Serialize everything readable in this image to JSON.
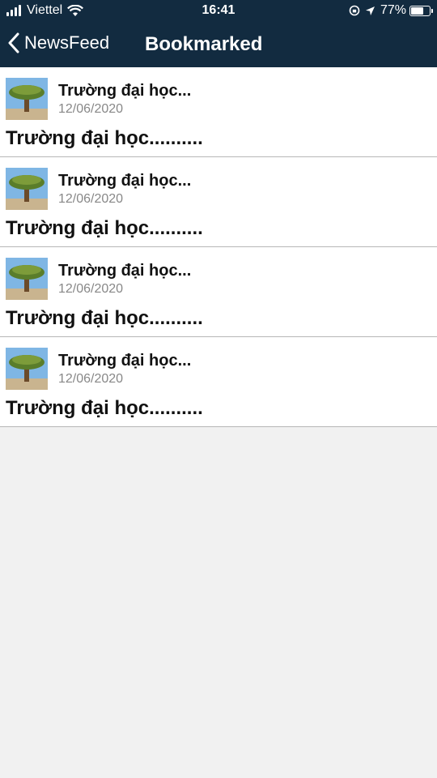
{
  "status_bar": {
    "carrier": "Viettel",
    "time": "16:41",
    "battery": "77%",
    "battery_level": 0.77,
    "icons": [
      "signal-icon",
      "wifi-icon",
      "orientation-lock-icon",
      "location-icon",
      "battery-icon"
    ]
  },
  "nav": {
    "back_label": "NewsFeed",
    "title": "Bookmarked"
  },
  "colors": {
    "header_bg": "#122b40",
    "list_bg": "#ffffff",
    "page_bg": "#f1f1f1",
    "date_text": "#888888"
  },
  "bookmarks": [
    {
      "title": "Trường đại học...",
      "date": "12/06/2020",
      "headline": "Trường đại học.........."
    },
    {
      "title": "Trường đại học...",
      "date": "12/06/2020",
      "headline": "Trường đại học.........."
    },
    {
      "title": "Trường đại học...",
      "date": "12/06/2020",
      "headline": "Trường đại học.........."
    },
    {
      "title": "Trường đại học...",
      "date": "12/06/2020",
      "headline": "Trường đại học.........."
    }
  ]
}
